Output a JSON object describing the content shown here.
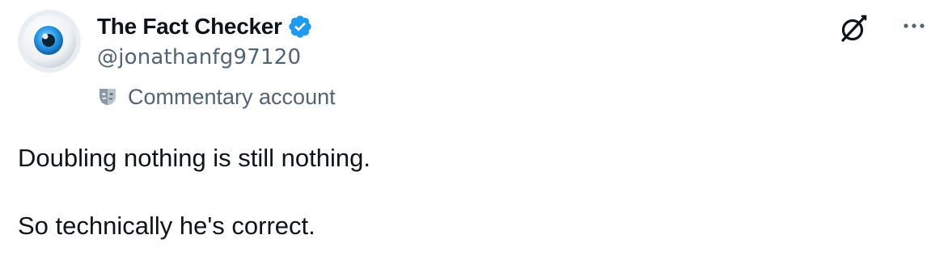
{
  "author": {
    "display_name": "The Fact Checker",
    "handle": "@jonathanfg97120",
    "verified": true,
    "verified_color": "#1d9bf0",
    "avatar_icon": "eyeball-avatar"
  },
  "account_label": {
    "icon": "theater-mask-icon",
    "text": "Commentary account"
  },
  "actions": {
    "grok_icon": "grok-icon",
    "more_icon": "more-horizontal-icon"
  },
  "tweet": {
    "paragraphs": [
      "Doubling nothing is still nothing.",
      "So technically he's correct."
    ]
  },
  "colors": {
    "text_primary": "#0f1419",
    "text_secondary": "#536471",
    "accent": "#1d9bf0",
    "background": "#ffffff"
  }
}
